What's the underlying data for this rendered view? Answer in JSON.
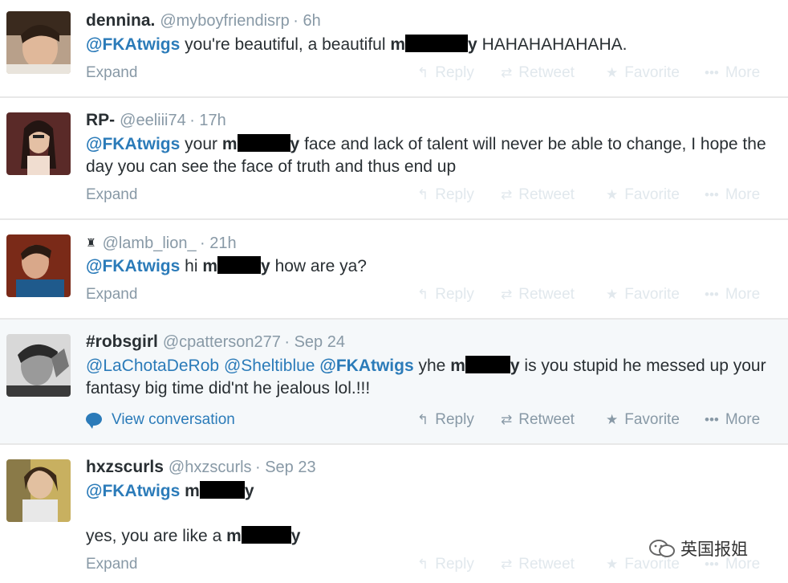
{
  "actions": {
    "reply": "Reply",
    "retweet": "Retweet",
    "favorite": "Favorite",
    "more": "More"
  },
  "tweets": [
    {
      "name": "dennina.",
      "handle": "@myboyfriendisrp",
      "time": "· 6h",
      "mention": "@FKAtwigs",
      "t1": "you're beautiful, a beautiful",
      "r_pre": "m",
      "r_post": "y",
      "t2": "HAHAHAHAHAHA.",
      "expand": "Expand"
    },
    {
      "name": "RP-",
      "handle": "@eeliii74",
      "time": "· 17h",
      "mention": "@FKAtwigs",
      "t1": "your",
      "r_pre": "m",
      "r_post": "y",
      "t2": "face and lack of talent will never be able to change, I hope the day you can see the face of truth and thus end up",
      "expand": "Expand"
    },
    {
      "name": "",
      "handle": "@lamb_lion_",
      "time": "· 21h",
      "mention": "@FKAtwigs",
      "t1": "hi",
      "r_pre": "m",
      "r_post": "y",
      "t2": "how are ya?",
      "expand": "Expand"
    },
    {
      "name": "#robsgirl",
      "handle": "@cpatterson277",
      "time": "· Sep 24",
      "m1": "@LaChotaDeRob",
      "m2": "@Sheltiblue",
      "m3": "@FKAtwigs",
      "t1": "yhe",
      "r_pre": "m",
      "r_post": "y",
      "t2": "is you stupid he messed up your fantasy big time did'nt he jealous lol.!!!",
      "expand": "View conversation"
    },
    {
      "name": "hxzscurls",
      "handle": "@hxzscurls",
      "time": "· Sep 23",
      "mention": "@FKAtwigs",
      "r_pre": "m",
      "r_post": "y",
      "line2": "yes, you are like a",
      "expand": "Expand"
    }
  ],
  "watermark": {
    "text": "英国报姐"
  },
  "colors": {
    "link": "#2b7bb9",
    "muted": "#8899a6",
    "highlight_bg": "#f5f8fa"
  }
}
